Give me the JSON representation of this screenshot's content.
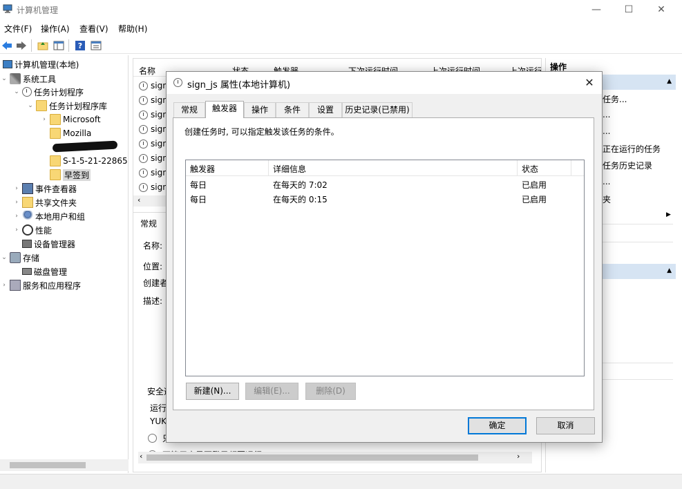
{
  "window": {
    "title": "计算机管理",
    "controls": {
      "minimize": "—",
      "maximize": "☐",
      "close": "✕"
    }
  },
  "menu": [
    "文件(F)",
    "操作(A)",
    "查看(V)",
    "帮助(H)"
  ],
  "toolbar": {
    "icons": [
      "back-icon",
      "forward-icon",
      "up-folder-icon",
      "show-hide-tree-icon",
      "help-icon",
      "properties-icon"
    ]
  },
  "tree": {
    "root": "计算机管理(本地)",
    "system_tools": "系统工具",
    "task_scheduler": "任务计划程序",
    "task_library": "任务计划程序库",
    "microsoft": "Microsoft",
    "mozilla": "Mozilla",
    "sid_folder": "S-1-5-21-22865",
    "checkin": "早签到",
    "event_viewer": "事件查看器",
    "shared_folders": "共享文件夹",
    "local_users": "本地用户和组",
    "performance": "性能",
    "device_manager": "设备管理器",
    "storage": "存储",
    "disk_management": "磁盘管理",
    "services_apps": "服务和应用程序"
  },
  "middle": {
    "columns": [
      "名称",
      "状态",
      "触发器",
      "下次运行时间",
      "上次运行时间",
      "上次运行"
    ],
    "task_rows": [
      "sign",
      "sign",
      "sign",
      "sign",
      "sign",
      "sign",
      "sign",
      "sign"
    ],
    "general_tab": "常规",
    "labels": {
      "name": "名称:",
      "location": "位置:",
      "author": "创建者",
      "description": "描述:"
    },
    "security": "安全选",
    "run_as": "运行",
    "user": "YUK",
    "radio1": "只",
    "radio2": "不管用户是否登录都要运行"
  },
  "actions": {
    "title": "操作",
    "items": [
      "任务...",
      "...",
      "...",
      "正在运行的任务",
      "任务历史记录",
      "...",
      "夹"
    ]
  },
  "dialog": {
    "title": "sign_js 属性(本地计算机)",
    "close": "✕",
    "tabs": [
      "常规",
      "触发器",
      "操作",
      "条件",
      "设置",
      "历史记录(已禁用)"
    ],
    "active_tab": "触发器",
    "description": "创建任务时, 可以指定触发该任务的条件。",
    "table": {
      "columns": [
        "触发器",
        "详细信息",
        "状态"
      ],
      "rows": [
        {
          "trigger": "每日",
          "details": "在每天的 7:02",
          "status": "已启用"
        },
        {
          "trigger": "每日",
          "details": "在每天的 0:15",
          "status": "已启用"
        }
      ]
    },
    "buttons": {
      "new": "新建(N)...",
      "edit": "编辑(E)...",
      "delete": "删除(D)",
      "ok": "确定",
      "cancel": "取消"
    }
  }
}
